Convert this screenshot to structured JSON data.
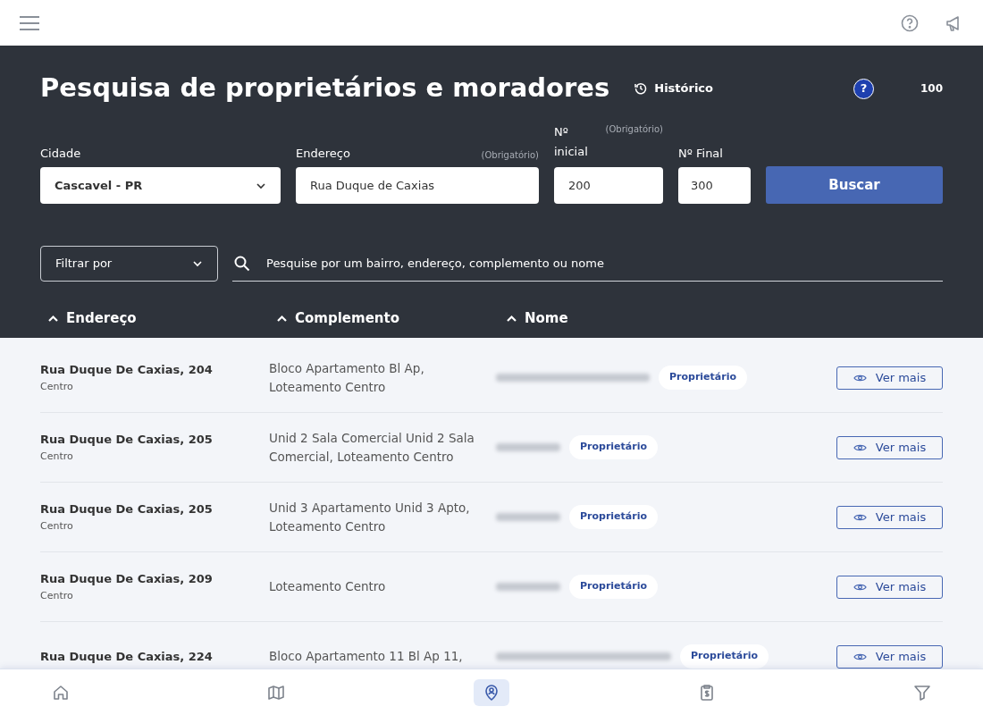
{
  "header": {
    "title": "Pesquisa de proprietários e moradores",
    "history": "Histórico",
    "help": "?",
    "count": "100"
  },
  "form": {
    "city": {
      "label": "Cidade",
      "value": "Cascavel - PR"
    },
    "address": {
      "label": "Endereço",
      "note": "(Obrigatório)",
      "value": "Rua Duque de Caxias"
    },
    "start": {
      "label": "Nº inicial",
      "note": "(Obrigatório)",
      "value": "200"
    },
    "end": {
      "label": "Nº Final",
      "value": "300"
    },
    "button": "Buscar"
  },
  "filter": {
    "select": "Filtrar por",
    "search_placeholder": "Pesquise por um bairro, endereço, complemento ou nome"
  },
  "columns": [
    {
      "label": "Endereço"
    },
    {
      "label": "Complemento"
    },
    {
      "label": "Nome"
    }
  ],
  "rows": [
    {
      "address": "Rua Duque De Caxias, 204",
      "district": "Centro",
      "complement": "Bloco Apartamento Bl Ap, Loteamento Centro",
      "name_redacted": true,
      "badge": "Proprietário",
      "action": "Ver mais"
    },
    {
      "address": "Rua Duque De Caxias, 205",
      "district": "Centro",
      "complement": "Unid 2 Sala Comercial Unid 2 Sala Comercial, Loteamento Centro",
      "name_redacted": true,
      "badge": "Proprietário",
      "action": "Ver mais"
    },
    {
      "address": "Rua Duque De Caxias, 205",
      "district": "Centro",
      "complement": "Unid 3 Apartamento Unid 3 Apto, Loteamento Centro",
      "name_redacted": true,
      "badge": "Proprietário",
      "action": "Ver mais"
    },
    {
      "address": "Rua Duque De Caxias, 209",
      "district": "Centro",
      "complement": "Loteamento Centro",
      "name_redacted": true,
      "badge": "Proprietário",
      "action": "Ver mais"
    },
    {
      "address": "Rua Duque De Caxias, 224",
      "complement": "Bloco Apartamento 11 Bl Ap 11,",
      "name_redacted": true,
      "badge": "Proprietário",
      "action": "Ver mais"
    }
  ],
  "bottom_nav": [
    {
      "kind": "home",
      "selected": false
    },
    {
      "kind": "map",
      "selected": false
    },
    {
      "kind": "pin",
      "selected": true
    },
    {
      "kind": "clipboard",
      "selected": false
    },
    {
      "kind": "filter",
      "selected": false
    }
  ]
}
